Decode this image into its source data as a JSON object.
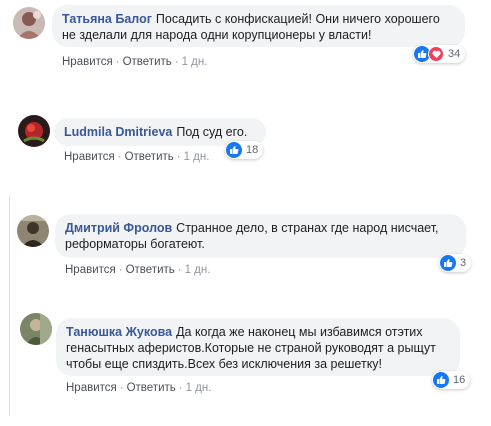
{
  "comments": [
    {
      "author": "Татьяна Балог",
      "text_line1": "Посадить с конфискацией! Они ничего хорошего",
      "text_line2": "не зделали для народа одни корупционеры у власти!",
      "like_label": "Нравится",
      "reply_label": "Ответить",
      "time": "1 дн.",
      "reaction_count": "34",
      "reactions": [
        "like-icon",
        "love-icon"
      ]
    },
    {
      "author": "Ludmila Dmitrieva",
      "text_line1": "Под суд его.",
      "like_label": "Нравится",
      "reply_label": "Ответить",
      "time": "1 дн.",
      "reaction_count": "18",
      "reactions": [
        "like-icon"
      ]
    },
    {
      "author": "Дмитрий Фролов",
      "text_line1": "Странное дело, в странах где народ нисчает,",
      "text_line2": "реформаторы богатеют.",
      "like_label": "Нравится",
      "reply_label": "Ответить",
      "time": "1 дн.",
      "reaction_count": "3",
      "reactions": [
        "like-icon"
      ]
    },
    {
      "author": "Танюшка Жукова",
      "text_line1": "Да когда же наконец мы избавимся отэтих",
      "text_line2": "генасытных аферистов.Которые не страной руководят а рыщут",
      "text_line3": "чтобы еще спиздить.Всех без исключения за решетку!",
      "like_label": "Нравится",
      "reply_label": "Ответить",
      "time": "1 дн.",
      "reaction_count": "16",
      "reactions": [
        "like-icon"
      ]
    }
  ],
  "separator": "·",
  "colors": {
    "author": "#385898",
    "bubble": "#f2f3f5",
    "like": "#1877f2",
    "love": "#f33e58"
  }
}
